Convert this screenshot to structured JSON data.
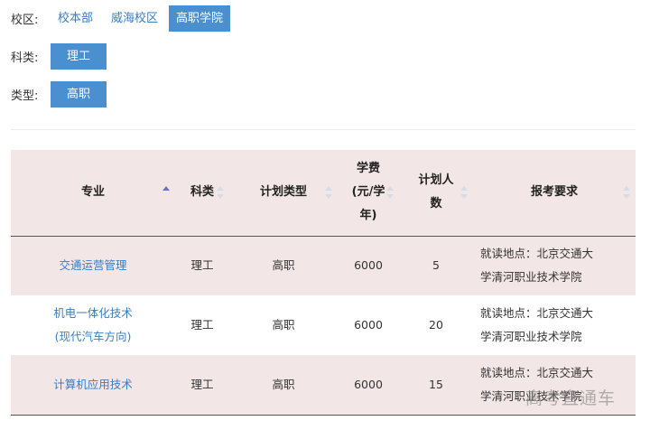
{
  "filters": {
    "campus": {
      "label": "校区:",
      "options": [
        "校本部",
        "威海校区",
        "高职学院"
      ],
      "selected": "高职学院"
    },
    "subject": {
      "label": "科类:",
      "value": "理工"
    },
    "type": {
      "label": "类型:",
      "value": "高职"
    }
  },
  "table": {
    "headers": [
      "专业",
      "科类",
      "计划类型",
      "学费",
      "(元/学",
      "年)",
      "计划人",
      "数",
      "报考要求"
    ],
    "sort": {
      "column": "专业",
      "direction": "asc"
    },
    "rows": [
      {
        "major_line1": "交通运营管理",
        "major_line2": "",
        "subject": "理工",
        "plan_type": "高职",
        "tuition": "6000",
        "count": "5",
        "req_line1": "就读地点：北京交通大",
        "req_line2": "学清河职业技术学院"
      },
      {
        "major_line1": "机电一体化技术",
        "major_line2": "(现代汽车方向)",
        "subject": "理工",
        "plan_type": "高职",
        "tuition": "6000",
        "count": "20",
        "req_line1": "就读地点：北京交通大",
        "req_line2": "学清河职业技术学院"
      },
      {
        "major_line1": "计算机应用技术",
        "major_line2": "",
        "subject": "理工",
        "plan_type": "高职",
        "tuition": "6000",
        "count": "15",
        "req_line1": "就读地点：北京交通大",
        "req_line2": "学清河职业技术学院"
      }
    ]
  },
  "watermark": "高考直通车"
}
